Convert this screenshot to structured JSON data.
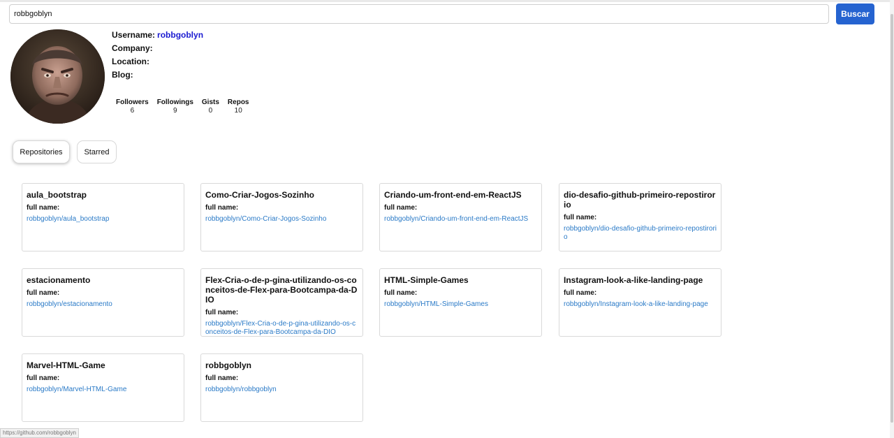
{
  "search": {
    "value": "robbgoblyn",
    "button_label": "Buscar"
  },
  "profile": {
    "username_label": "Username:",
    "username": "robbgoblyn",
    "company_label": "Company:",
    "location_label": "Location:",
    "blog_label": "Blog:"
  },
  "stats": [
    {
      "label": "Followers",
      "value": "6"
    },
    {
      "label": "Followings",
      "value": "9"
    },
    {
      "label": "Gists",
      "value": "0"
    },
    {
      "label": "Repos",
      "value": "10"
    }
  ],
  "tabs": {
    "repositories": "Repositories",
    "starred": "Starred"
  },
  "repos": [
    {
      "name": "aula_bootstrap",
      "full_name_label": "full name:",
      "full_name": "robbgoblyn/aula_bootstrap"
    },
    {
      "name": "Como-Criar-Jogos-Sozinho",
      "full_name_label": "full name:",
      "full_name": "robbgoblyn/Como-Criar-Jogos-Sozinho"
    },
    {
      "name": "Criando-um-front-end-em-ReactJS",
      "full_name_label": "full name:",
      "full_name": "robbgoblyn/Criando-um-front-end-em-ReactJS"
    },
    {
      "name": "dio-desafio-github-primeiro-repostirorio",
      "full_name_label": "full name:",
      "full_name": "robbgoblyn/dio-desafio-github-primeiro-repostirorio"
    },
    {
      "name": "estacionamento",
      "full_name_label": "full name:",
      "full_name": "robbgoblyn/estacionamento"
    },
    {
      "name": "Flex-Cria-o-de-p-gina-utilizando-os-conceitos-de-Flex-para-Bootcampa-da-DIO",
      "full_name_label": "full name:",
      "full_name": "robbgoblyn/Flex-Cria-o-de-p-gina-utilizando-os-conceitos-de-Flex-para-Bootcampa-da-DIO"
    },
    {
      "name": "HTML-Simple-Games",
      "full_name_label": "full name:",
      "full_name": "robbgoblyn/HTML-Simple-Games"
    },
    {
      "name": "Instagram-look-a-like-landing-page",
      "full_name_label": "full name:",
      "full_name": "robbgoblyn/Instagram-look-a-like-landing-page"
    },
    {
      "name": "Marvel-HTML-Game",
      "full_name_label": "full name:",
      "full_name": "robbgoblyn/Marvel-HTML-Game"
    },
    {
      "name": "robbgoblyn",
      "full_name_label": "full name:",
      "full_name": "robbgoblyn/robbgoblyn"
    }
  ],
  "status_bar": {
    "url": "https://github.com/robbgoblyn"
  },
  "colors": {
    "accent": "#2563d0",
    "username": "#1a1ad1",
    "link": "#2a7ac7"
  }
}
